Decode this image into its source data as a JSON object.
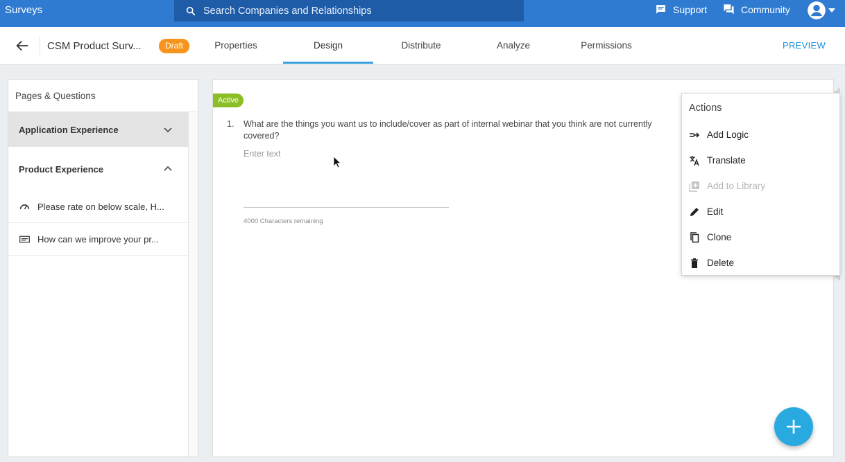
{
  "app": {
    "title": "Surveys"
  },
  "search": {
    "placeholder": "Search Companies and Relationships"
  },
  "topnav": {
    "support": "Support",
    "community": "Community"
  },
  "header": {
    "survey_name": "CSM Product Surv...",
    "status_badge": "Draft",
    "tabs": [
      {
        "label": "Properties"
      },
      {
        "label": "Design"
      },
      {
        "label": "Distribute"
      },
      {
        "label": "Analyze"
      },
      {
        "label": "Permissions"
      }
    ],
    "active_tab": "Design",
    "preview_label": "PREVIEW"
  },
  "sidebar": {
    "title": "Pages & Questions",
    "sections": [
      {
        "label": "Application Experience",
        "expanded": false
      },
      {
        "label": "Product Experience",
        "expanded": true
      }
    ],
    "questions": [
      {
        "label": "Please rate on below scale, H...",
        "icon": "gauge-icon"
      },
      {
        "label": "How can we improve your pr...",
        "icon": "text-field-icon"
      }
    ]
  },
  "question": {
    "status": "Active",
    "number": "1.",
    "text": "What are the things you want us to include/cover as part of internal webinar that you think are not currently covered?",
    "input_value": "",
    "input_placeholder": "Enter text",
    "chars_remaining": "4000 Characters remaining"
  },
  "actions_menu": {
    "title": "Actions",
    "items": [
      {
        "label": "Add Logic",
        "icon": "logic-icon",
        "enabled": true
      },
      {
        "label": "Translate",
        "icon": "translate-icon",
        "enabled": true
      },
      {
        "label": "Add to Library",
        "icon": "library-add-icon",
        "enabled": false
      },
      {
        "label": "Edit",
        "icon": "pencil-icon",
        "enabled": true
      },
      {
        "label": "Clone",
        "icon": "copy-icon",
        "enabled": true
      },
      {
        "label": "Delete",
        "icon": "trash-icon",
        "enabled": true
      }
    ]
  },
  "colors": {
    "topbar": "#2f7bd2",
    "search_bg": "#1e5ca8",
    "draft_badge": "#f7941d",
    "active_tag": "#8cbf26",
    "active_tab_underline": "#39a0e0",
    "fab": "#28a9e0"
  }
}
